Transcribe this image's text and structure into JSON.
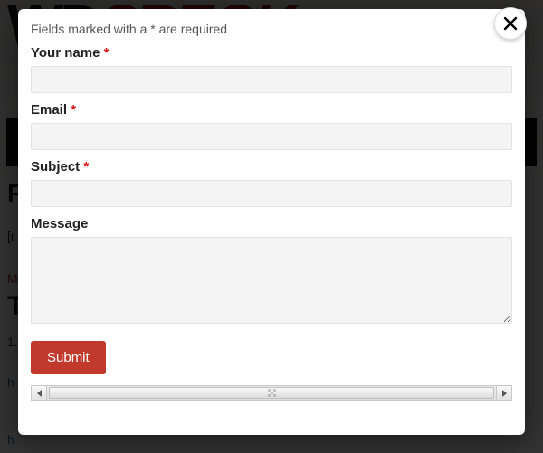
{
  "background": {
    "logo_part1": "WD",
    "logo_part2": "CREOK",
    "heading1": "P",
    "text2": "[r",
    "text3": "M",
    "heading2": "T",
    "text5": "1.",
    "text6": "h",
    "text7": "h"
  },
  "modal": {
    "hint": "Fields marked with a * are required",
    "required_marker": "*",
    "fields": {
      "name": {
        "label": "Your name",
        "required": true,
        "value": ""
      },
      "email": {
        "label": "Email",
        "required": true,
        "value": ""
      },
      "subject": {
        "label": "Subject",
        "required": true,
        "value": ""
      },
      "message": {
        "label": "Message",
        "required": false,
        "value": ""
      }
    },
    "submit_label": "Submit"
  },
  "colors": {
    "accent": "#c1392b",
    "required": "#dd1111"
  }
}
